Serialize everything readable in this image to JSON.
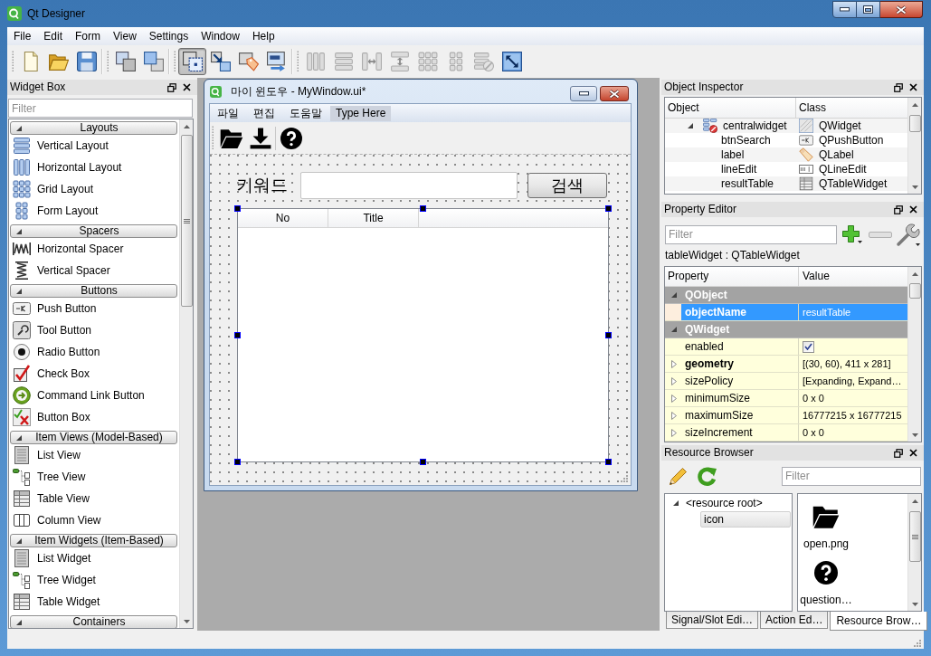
{
  "window": {
    "title": "Qt Designer"
  },
  "menu": [
    "File",
    "Edit",
    "Form",
    "View",
    "Settings",
    "Window",
    "Help"
  ],
  "toolbar": [
    [
      {
        "kind": "new",
        "disabled": false
      },
      {
        "kind": "open",
        "disabled": false
      },
      {
        "kind": "save",
        "disabled": false
      }
    ],
    [
      {
        "kind": "back",
        "disabled": false
      },
      {
        "kind": "front",
        "disabled": false
      }
    ],
    [
      {
        "kind": "widgets",
        "selected": true,
        "disabled": false
      },
      {
        "kind": "signals",
        "selected": false,
        "disabled": false
      },
      {
        "kind": "buddies",
        "selected": false,
        "disabled": false
      },
      {
        "kind": "taborder",
        "selected": false,
        "disabled": false
      }
    ],
    [
      {
        "kind": "hbox",
        "disabled": true
      },
      {
        "kind": "vbox",
        "disabled": true
      },
      {
        "kind": "hsplit",
        "disabled": true
      },
      {
        "kind": "vsplit",
        "disabled": true
      },
      {
        "kind": "grid",
        "disabled": true
      },
      {
        "kind": "form",
        "disabled": true
      },
      {
        "kind": "break",
        "disabled": true
      },
      {
        "kind": "adjust",
        "disabled": false
      }
    ]
  ],
  "widget_box": {
    "title": "Widget Box",
    "filter": {
      "placeholder": "Filter"
    },
    "categories": [
      {
        "label": "Layouts",
        "expanded": true,
        "items": [
          {
            "label": "Vertical Layout",
            "kind": "vlayout"
          },
          {
            "label": "Horizontal Layout",
            "kind": "hlayout"
          },
          {
            "label": "Grid Layout",
            "kind": "grid"
          },
          {
            "label": "Form Layout",
            "kind": "form"
          }
        ]
      },
      {
        "label": "Spacers",
        "expanded": true,
        "items": [
          {
            "label": "Horizontal Spacer",
            "kind": "hspacer"
          },
          {
            "label": "Vertical Spacer",
            "kind": "vspacer"
          }
        ]
      },
      {
        "label": "Buttons",
        "expanded": true,
        "items": [
          {
            "label": "Push Button",
            "kind": "pushbutton"
          },
          {
            "label": "Tool Button",
            "kind": "toolbutton"
          },
          {
            "label": "Radio Button",
            "kind": "radio"
          },
          {
            "label": "Check Box",
            "kind": "checkbox"
          },
          {
            "label": "Command Link Button",
            "kind": "commandlink"
          },
          {
            "label": "Button Box",
            "kind": "buttonbox"
          }
        ]
      },
      {
        "label": "Item Views (Model-Based)",
        "expanded": true,
        "items": [
          {
            "label": "List View",
            "kind": "list"
          },
          {
            "label": "Tree View",
            "kind": "tree"
          },
          {
            "label": "Table View",
            "kind": "table"
          },
          {
            "label": "Column View",
            "kind": "columns"
          }
        ]
      },
      {
        "label": "Item Widgets (Item-Based)",
        "expanded": true,
        "items": [
          {
            "label": "List Widget",
            "kind": "list"
          },
          {
            "label": "Tree Widget",
            "kind": "tree"
          },
          {
            "label": "Table Widget",
            "kind": "table"
          }
        ]
      },
      {
        "label": "Containers",
        "expanded": true
      }
    ]
  },
  "form_window": {
    "title": "마이 윈도우 - MyWindow.ui*",
    "menu": [
      "파일",
      "편집",
      "도움말"
    ],
    "menu_placeholder": "Type Here",
    "label": "키워드",
    "button": "검색",
    "table": {
      "columns": [
        "No",
        "Title"
      ],
      "selected": true
    }
  },
  "object_inspector": {
    "title": "Object Inspector",
    "columns": [
      "Object",
      "Class"
    ],
    "tree": [
      {
        "object": "centralwidget",
        "class": "QWidget",
        "kind": "widget",
        "expanded": true,
        "children": [
          {
            "object": "btnSearch",
            "class": "QPushButton",
            "kind": "pushbutton"
          },
          {
            "object": "label",
            "class": "QLabel",
            "kind": "label"
          },
          {
            "object": "lineEdit",
            "class": "QLineEdit",
            "kind": "lineedit"
          },
          {
            "object": "resultTable",
            "class": "QTableWidget",
            "kind": "table"
          }
        ]
      }
    ]
  },
  "property_editor": {
    "title": "Property Editor",
    "filter": {
      "placeholder": "Filter"
    },
    "object_label": "tableWidget : QTableWidget",
    "columns": [
      "Property",
      "Value"
    ],
    "groups": [
      {
        "name": "QObject",
        "expanded": true,
        "color": "#fdeede",
        "properties": [
          {
            "name": "objectName",
            "kind": "text",
            "value": "resultTable",
            "selected": true,
            "modified": true
          }
        ]
      },
      {
        "name": "QWidget",
        "expanded": true,
        "color": "#ffffdc",
        "properties": [
          {
            "name": "enabled",
            "kind": "checkbox",
            "checked": true,
            "selected": false,
            "modified": false
          },
          {
            "name": "geometry",
            "kind": "text",
            "value": "[(30, 60), 411 x 281]",
            "selected": false,
            "modified": true,
            "expanded": false
          },
          {
            "name": "sizePolicy",
            "kind": "text",
            "value": "[Expanding, Expand…",
            "selected": false,
            "modified": false,
            "expanded": false
          },
          {
            "name": "minimumSize",
            "kind": "text",
            "value": "0 x 0",
            "selected": false,
            "modified": false,
            "expanded": false
          },
          {
            "name": "maximumSize",
            "kind": "text",
            "value": "16777215 x 16777215",
            "selected": false,
            "modified": false,
            "expanded": false
          },
          {
            "name": "sizeIncrement",
            "kind": "text",
            "value": "0 x 0",
            "selected": false,
            "modified": false,
            "expanded": false
          }
        ]
      }
    ]
  },
  "resource_browser": {
    "title": "Resource Browser",
    "filter": {
      "placeholder": "Filter"
    },
    "tree": [
      {
        "label": "<resource root>",
        "expanded": true,
        "selected": false,
        "children": [
          {
            "label": "icon",
            "selected": true
          }
        ]
      }
    ],
    "files": [
      {
        "name": "open.png",
        "kind": "folder"
      },
      {
        "name": "question…",
        "kind": "question"
      }
    ]
  },
  "bottom_tabs": [
    {
      "label": "Signal/Slot Edi…",
      "selected": false
    },
    {
      "label": "Action Ed…",
      "selected": false
    },
    {
      "label": "Resource Brow…",
      "selected": true
    }
  ]
}
